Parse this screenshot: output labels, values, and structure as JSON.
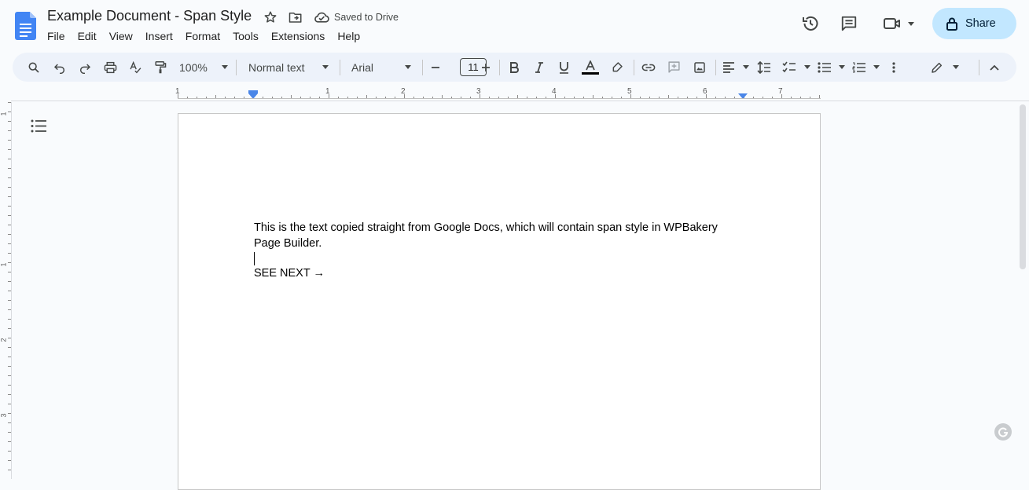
{
  "doc": {
    "title": "Example Document - Span Style",
    "saved_status": "Saved to Drive"
  },
  "menu": [
    "File",
    "Edit",
    "View",
    "Insert",
    "Format",
    "Tools",
    "Extensions",
    "Help"
  ],
  "share": {
    "label": "Share"
  },
  "toolbar": {
    "zoom": "100%",
    "style": "Normal text",
    "font": "Arial",
    "font_size": "11",
    "icons": [
      "search-icon",
      "undo-icon",
      "redo-icon",
      "print-icon",
      "spellcheck-icon",
      "paint-format-icon",
      "bold-icon",
      "italic-icon",
      "underline-icon",
      "text-color-icon",
      "highlight-icon",
      "link-icon",
      "comment-icon",
      "image-icon",
      "align-icon",
      "line-spacing-icon",
      "checklist-icon",
      "bullet-list-icon",
      "numbered-list-icon",
      "more-icon",
      "edit-mode-icon",
      "collapse-icon"
    ]
  },
  "ruler": {
    "labels": [
      "1",
      "1",
      "2",
      "3",
      "4",
      "5",
      "6",
      "7"
    ]
  },
  "vertical_ruler": {
    "labels": [
      "1",
      "1",
      "2",
      "3"
    ]
  },
  "content": {
    "paragraph": "This is the text copied straight from Google Docs, which will contain span style in WPBakery Page Builder.",
    "next": "SEE NEXT →"
  },
  "colors": {
    "accent": "#c2e7ff",
    "toolbar_bg": "#edf2fa",
    "doc_blue": "#4285f4",
    "ruler_marker": "#4a86e8"
  }
}
